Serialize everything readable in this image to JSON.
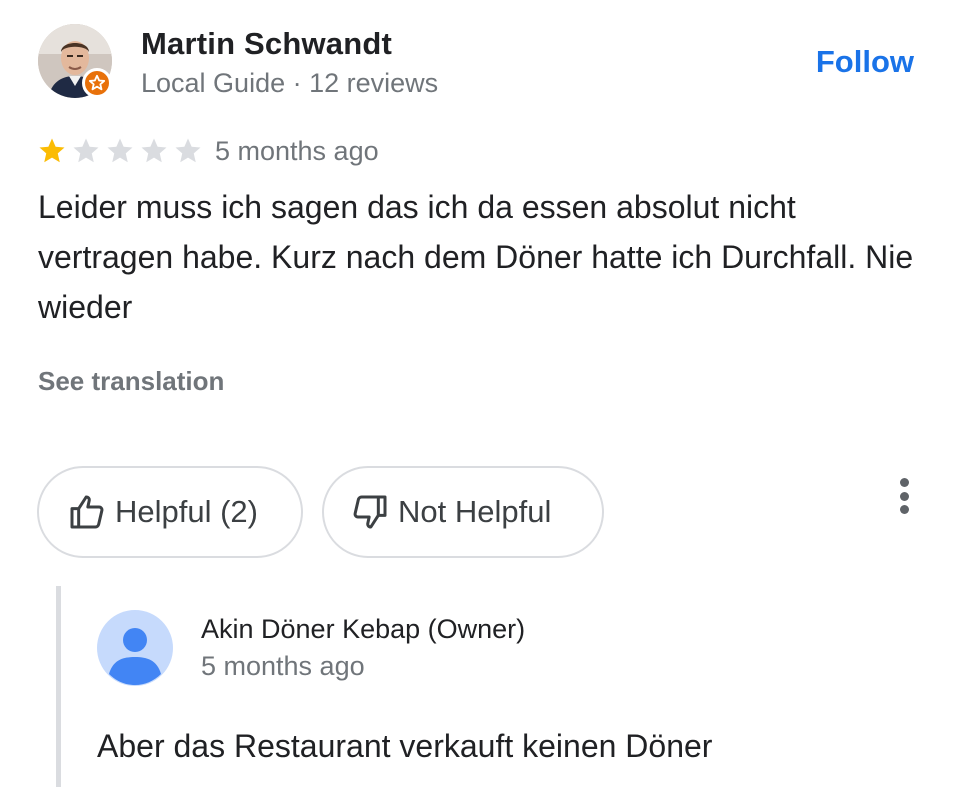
{
  "review": {
    "author_name": "Martin Schwandt",
    "author_meta": "Local Guide · 12 reviews",
    "follow_label": "Follow",
    "rating": 1,
    "rating_max": 5,
    "time_ago": "5 months ago",
    "text": "Leider muss ich sagen das ich da essen absolut nicht vertragen habe. Kurz nach dem Döner hatte ich Durchfall. Nie wieder",
    "see_translation_label": "See translation"
  },
  "actions": {
    "helpful_label": "Helpful (2)",
    "not_helpful_label": "Not Helpful"
  },
  "owner_reply": {
    "owner_name": "Akin Döner Kebap (Owner)",
    "time_ago": "5 months ago",
    "text": "Aber das Restaurant verkauft keinen Döner"
  },
  "colors": {
    "accent": "#1a73e8",
    "star_filled": "#fbbc04",
    "star_empty": "#dadce0",
    "badge": "#e8710a",
    "owner_avatar": "#4285f4"
  },
  "icons": {
    "avatar": "user-photo-icon",
    "badge": "local-guide-star-icon",
    "helpful": "thumbs-up-icon",
    "not_helpful": "thumbs-down-icon",
    "more": "more-vert-icon",
    "owner_avatar": "person-icon"
  }
}
